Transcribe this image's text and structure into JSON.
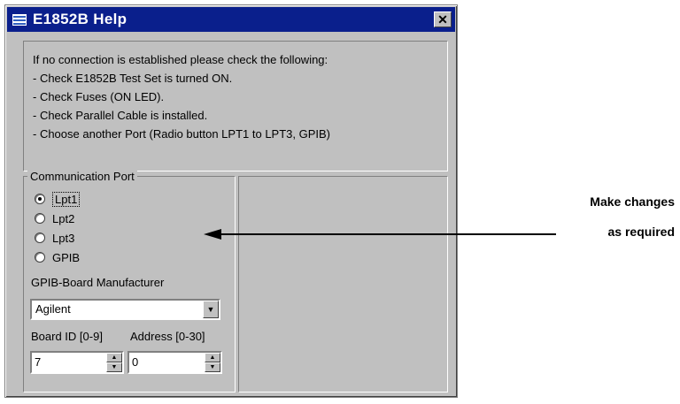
{
  "window": {
    "title": "E1852B Help",
    "close_glyph": "✕"
  },
  "info": {
    "lines": [
      "If no connection is established please check the following:",
      "- Check E1852B Test Set is turned ON.",
      "- Check Fuses (ON LED).",
      "- Check Parallel Cable is installed.",
      "- Choose another Port (Radio button LPT1 to LPT3, GPIB)"
    ]
  },
  "port": {
    "group_title": "Communication Port",
    "options": [
      {
        "label": "Lpt1",
        "checked": true
      },
      {
        "label": "Lpt2",
        "checked": false
      },
      {
        "label": "Lpt3",
        "checked": false
      },
      {
        "label": "GPIB",
        "checked": false
      }
    ],
    "manufacturer_label": "GPIB-Board Manufacturer",
    "manufacturer_value": "Agilent",
    "board_id_label": "Board ID [0-9]",
    "address_label": "Address [0-30]",
    "board_id_value": "7",
    "address_value": "0"
  },
  "callout": {
    "line1": "Make changes",
    "line2": "as required"
  }
}
